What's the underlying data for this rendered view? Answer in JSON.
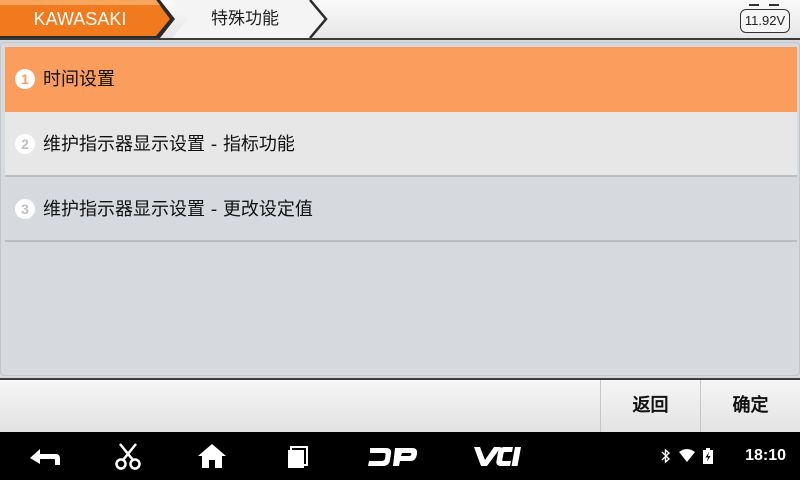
{
  "header": {
    "brand_crumb": "KAWASAKI",
    "section_crumb": "特殊功能",
    "battery_voltage": "11.92V",
    "colors": {
      "brand_crumb_bg": "#f27a1e",
      "accent": "#fb9d5c"
    }
  },
  "menu": {
    "items": [
      {
        "index": "1",
        "label": "时间设置",
        "selected": true
      },
      {
        "index": "2",
        "label": "维护指示器显示设置 - 指标功能",
        "selected": false
      },
      {
        "index": "3",
        "label": "维护指示器显示设置 - 更改设定值",
        "selected": false
      }
    ]
  },
  "actions": {
    "back_label": "返回",
    "ok_label": "确定"
  },
  "navbar": {
    "icons": [
      "back-icon",
      "scissors-icon",
      "home-icon",
      "recent-apps-icon",
      "dp-icon",
      "vci-icon"
    ],
    "dp_label": "DP",
    "vci_label": "VCI",
    "status_icons": [
      "bluetooth-icon",
      "wifi-icon",
      "battery-charging-icon"
    ],
    "time": "18:10"
  }
}
